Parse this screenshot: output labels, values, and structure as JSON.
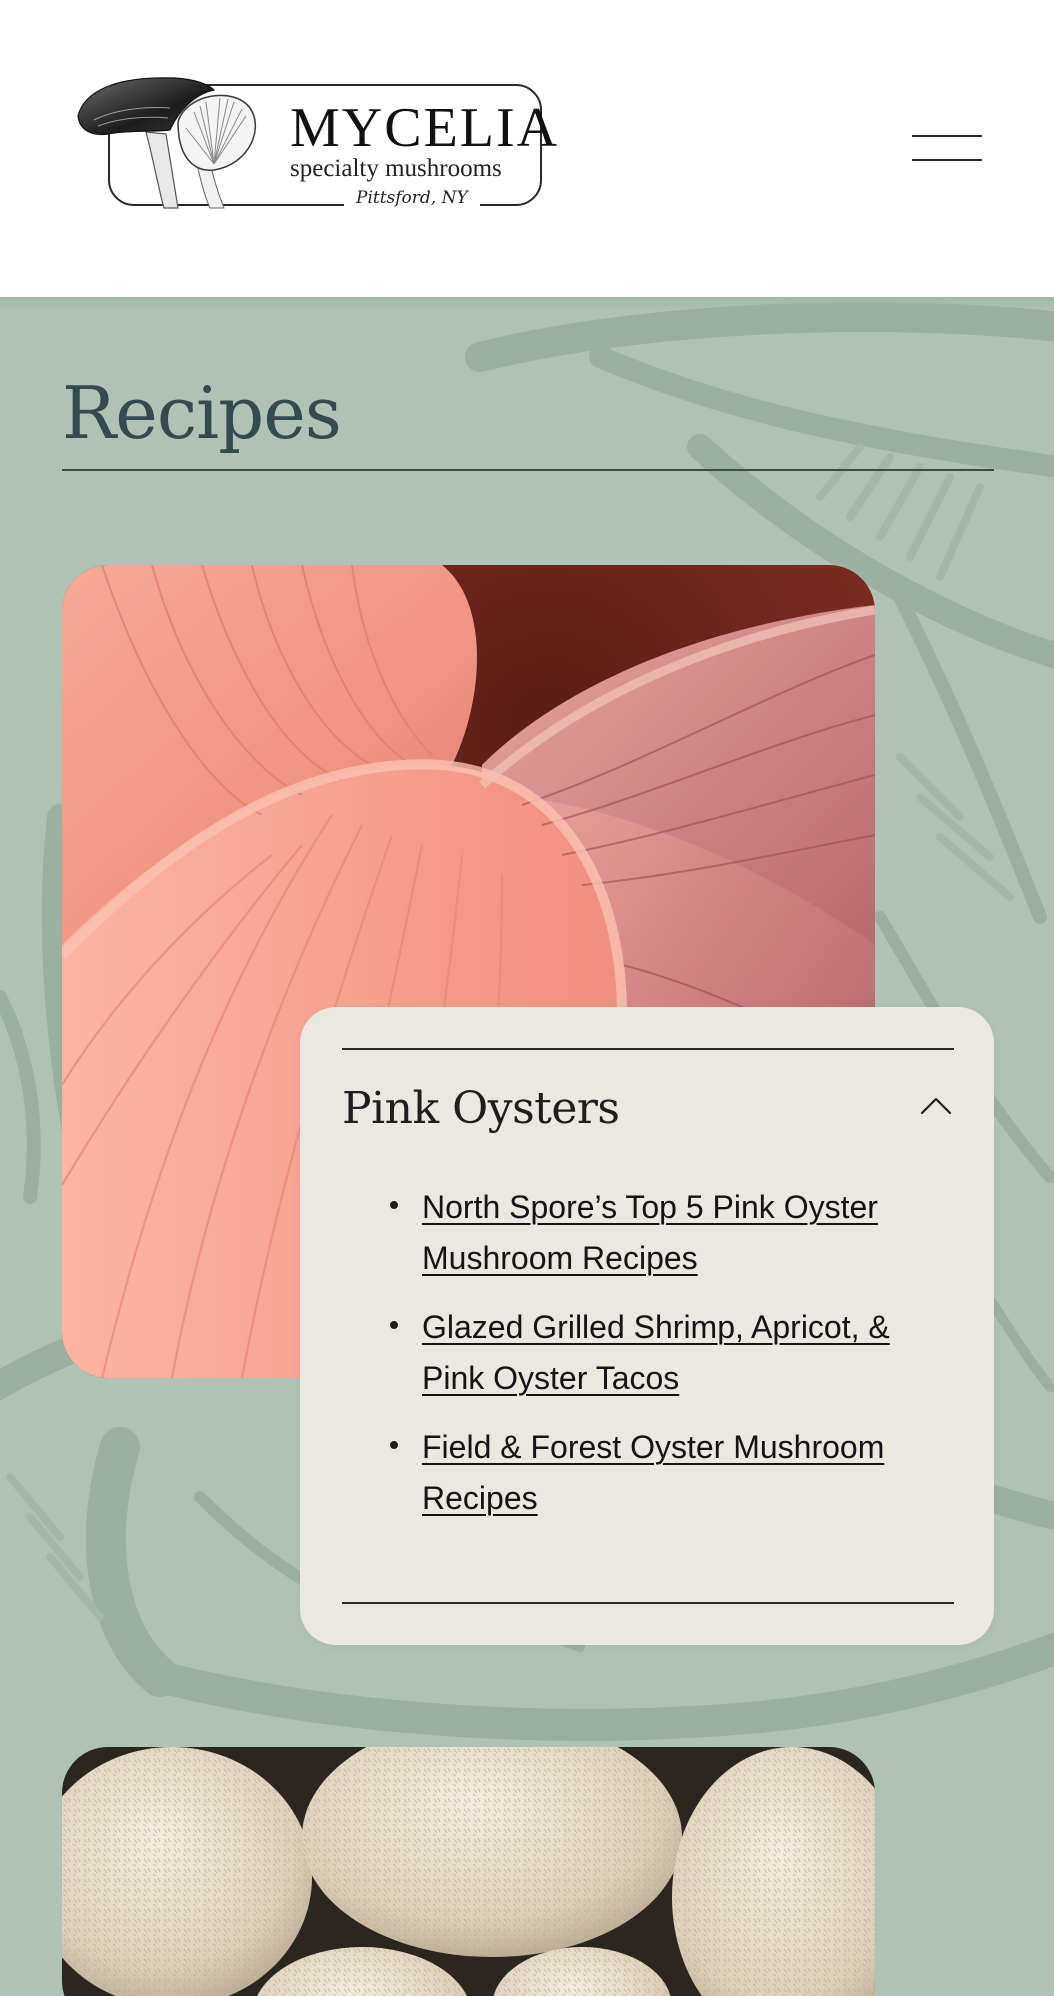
{
  "header": {
    "logo": {
      "wordmark": "MYCELIA",
      "tagline": "specialty mushrooms",
      "location": "Pittsford, NY",
      "icon": "oyster-mushroom-illustration"
    },
    "menu_icon": "hamburger-menu-icon"
  },
  "main": {
    "title": "Recipes",
    "sections": [
      {
        "image": "pink-oyster-mushroom-gills-photo",
        "card": {
          "title": "Pink Oysters",
          "toggle_icon": "chevron-up-icon",
          "links": [
            "North Spore’s Top 5 Pink Oyster Mushroom Recipes",
            "Glazed Grilled Shrimp, Apricot, & Pink Oyster Tacos",
            "Field & Forest Oyster Mushroom Recipes"
          ]
        }
      },
      {
        "image": "lions-mane-mushroom-photo"
      }
    ]
  },
  "colors": {
    "band_background": "#b0c2b5",
    "card_background": "#ebe7e1",
    "title_color": "#344a4e",
    "header_background": "#ffffff"
  }
}
